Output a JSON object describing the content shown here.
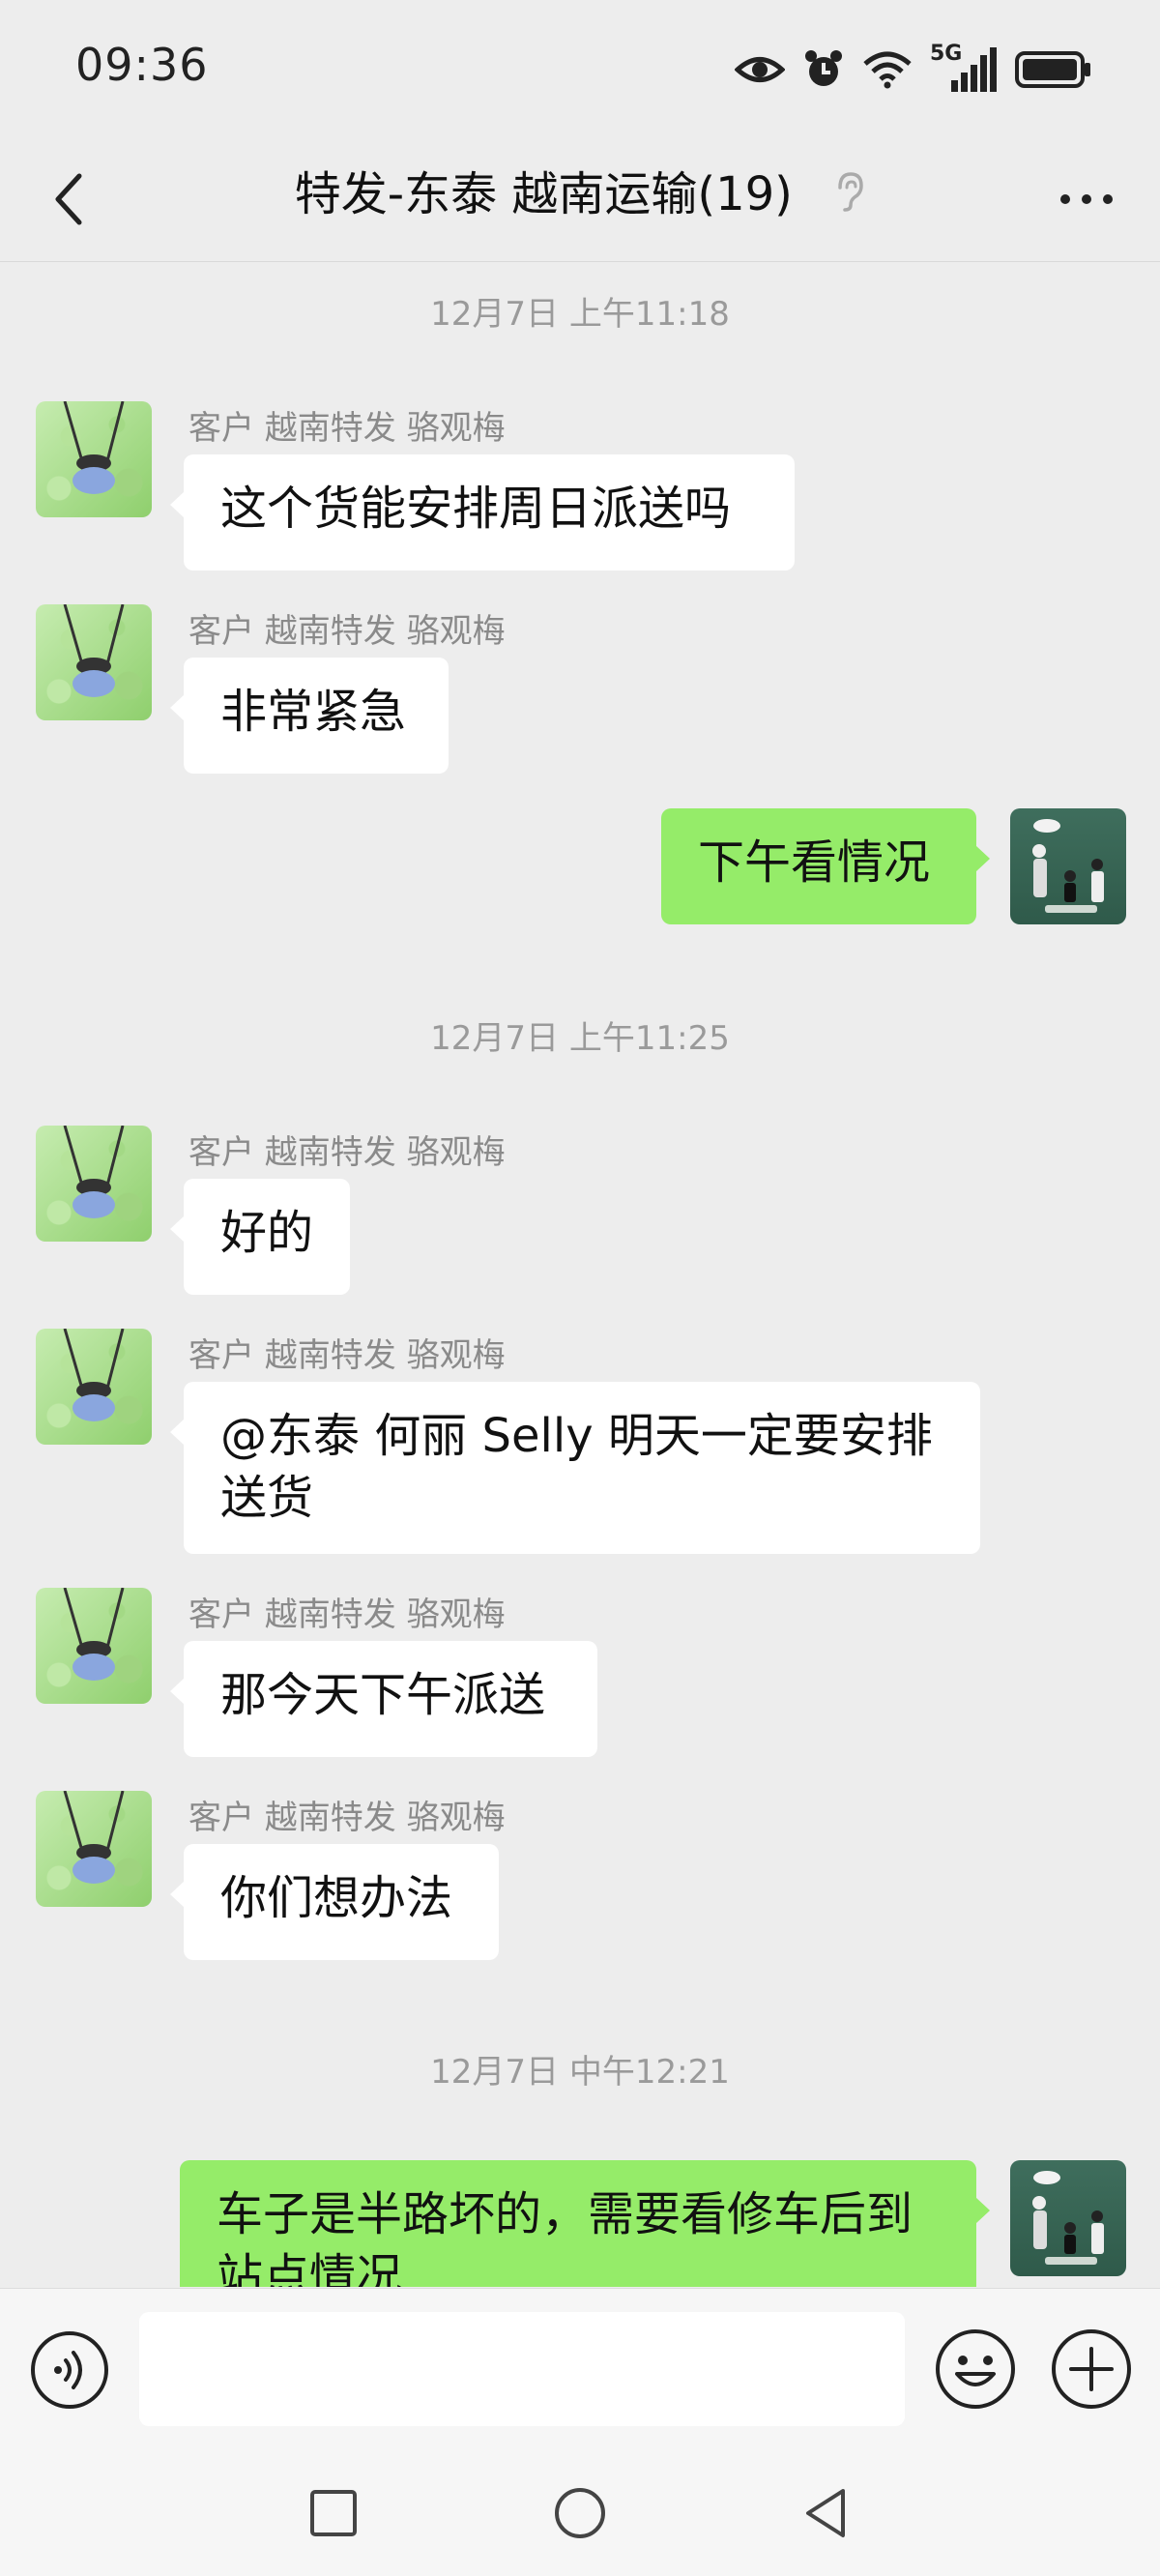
{
  "status_bar": {
    "time": "09:36",
    "icons": [
      "eye-icon",
      "alarm-icon",
      "wifi-icon",
      "5g-signal-icon",
      "battery-icon"
    ],
    "network_label": "5G"
  },
  "header": {
    "back_icon": "chevron-left-icon",
    "title": "特发-东泰 越南运输(19)",
    "ear_icon": "ear-icon",
    "more_icon": "more-dots-icon"
  },
  "colors": {
    "background": "#ededed",
    "incoming_bubble": "#ffffff",
    "outgoing_bubble": "#95ec69",
    "timestamp": "#9a9a9a",
    "sender_name": "#8a8a8a"
  },
  "messages": [
    {
      "type": "timestamp",
      "text": "12月7日 上午11:18"
    },
    {
      "type": "in",
      "sender": "客户 越南特发 骆观梅",
      "text": "这个货能安排周日派送吗"
    },
    {
      "type": "in",
      "sender": "客户 越南特发 骆观梅",
      "text": "非常紧急"
    },
    {
      "type": "out",
      "text": "下午看情况"
    },
    {
      "type": "timestamp",
      "text": "12月7日 上午11:25"
    },
    {
      "type": "in",
      "sender": "客户 越南特发 骆观梅",
      "text": "好的"
    },
    {
      "type": "in",
      "sender": "客户 越南特发 骆观梅",
      "text_line1": "@东泰 何丽 Selly  明天一定要安排",
      "text_line2": "送货"
    },
    {
      "type": "in",
      "sender": "客户 越南特发 骆观梅",
      "text": "那今天下午派送"
    },
    {
      "type": "in",
      "sender": "客户 越南特发 骆观梅",
      "text": "你们想办法"
    },
    {
      "type": "timestamp",
      "text": "12月7日 中午12:21"
    },
    {
      "type": "out",
      "text_line1": "车子是半路坏的，需要看修车后到",
      "text_line2": "站点情况"
    }
  ],
  "input_bar": {
    "voice_icon": "voice-icon",
    "input_value": "",
    "emoji_icon": "emoji-icon",
    "plus_icon": "plus-icon"
  },
  "nav_bar": {
    "icons": [
      "recent-apps-icon",
      "home-icon",
      "back-triangle-icon"
    ]
  }
}
